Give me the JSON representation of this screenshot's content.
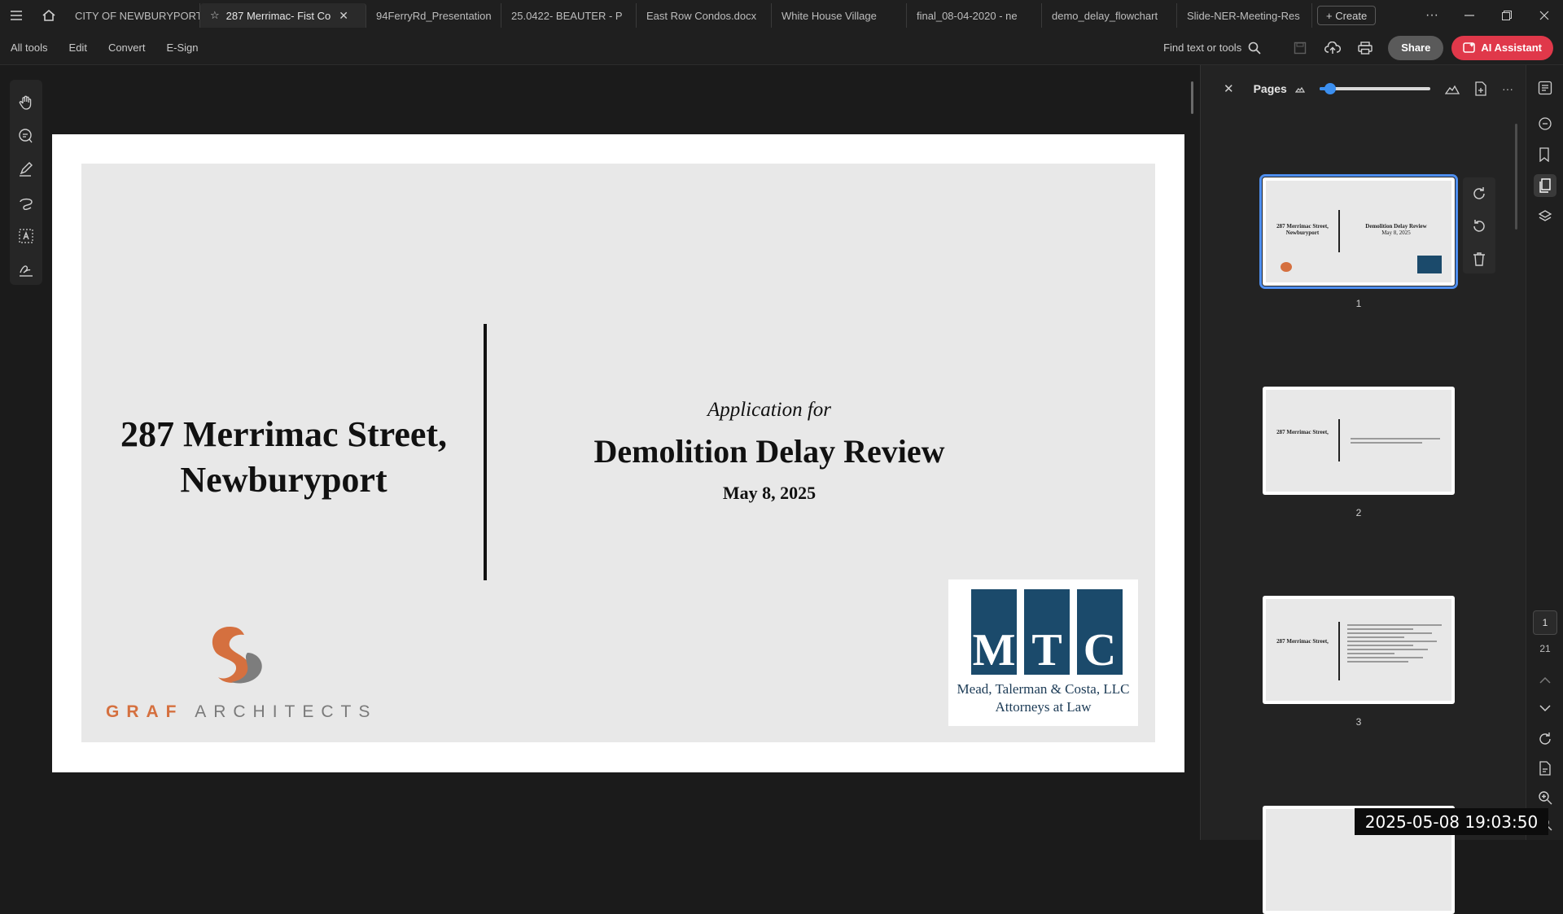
{
  "tabbar": {
    "tabs": [
      {
        "label": "CITY OF NEWBURYPORT"
      },
      {
        "label": "287 Merrimac- Fist Co"
      },
      {
        "label": "94FerryRd_Presentation"
      },
      {
        "label": "25.0422- BEAUTER - P"
      },
      {
        "label": "East Row Condos.docx"
      },
      {
        "label": "White House Village"
      },
      {
        "label": "final_08-04-2020 - ne"
      },
      {
        "label": "demo_delay_flowchart"
      },
      {
        "label": "Slide-NER-Meeting-Res"
      }
    ],
    "active_tab_index": 1,
    "create_label": "+ Create",
    "more_label": "···"
  },
  "menubar": {
    "items": [
      "All tools",
      "Edit",
      "Convert",
      "E-Sign"
    ],
    "find_label": "Find text or tools",
    "share_label": "Share",
    "ai_label": "AI Assistant"
  },
  "slide": {
    "address_line1": "287 Merrimac Street,",
    "address_line2": "Newburyport",
    "application_for": "Application for",
    "title": "Demolition Delay Review",
    "date": "May 8, 2025",
    "graf_part1": "GRAF",
    "graf_part2": "ARCHITECTS",
    "mtc_letters": [
      "M",
      "T",
      "C"
    ],
    "mtc_name_line1": "Mead, Talerman & Costa, LLC",
    "mtc_name_line2": "Attorneys at Law"
  },
  "pages_panel": {
    "title": "Pages",
    "thumbnail_zoom_fraction": 0.1,
    "pages": [
      {
        "number": "1"
      },
      {
        "number": "2"
      },
      {
        "number": "3"
      }
    ]
  },
  "navigation": {
    "current_page": "1",
    "total_pages": "21"
  },
  "overlay": {
    "timestamp": "2025-05-08 19:03:50"
  },
  "colors": {
    "accent_blue": "#4f8ff0",
    "ai_red": "#e0384a",
    "graf_orange": "#d5703f",
    "mtc_blue": "#1b4a6b"
  }
}
